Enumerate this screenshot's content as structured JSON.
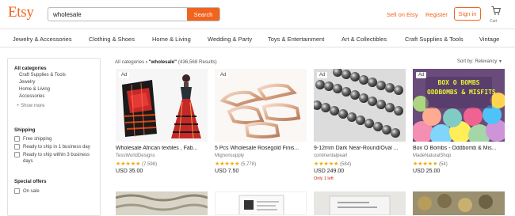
{
  "header": {
    "logo": "Etsy",
    "search_value": "wholesale",
    "search_button": "Search",
    "sell_link": "Sell on Etsy",
    "register_link": "Register",
    "signin_button": "Sign in",
    "cart_label": "Cart"
  },
  "categories": [
    "Jewelry & Accessories",
    "Clothing & Shoes",
    "Home & Living",
    "Wedding & Party",
    "Toys & Entertainment",
    "Art & Collectibles",
    "Craft Supplies & Tools",
    "Vintage"
  ],
  "sidebar": {
    "all_categories_heading": "All categories",
    "subcategories": [
      "Craft Supplies & Tools",
      "Jewelry",
      "Home & Living",
      "Accessories"
    ],
    "show_more": "+ Show more",
    "shipping_heading": "Shipping",
    "shipping_options": [
      "Free shipping",
      "Ready to ship in 1 business day",
      "Ready to ship within 3 business",
      "days"
    ],
    "special_heading": "Special offers",
    "special_options": [
      "On sale"
    ]
  },
  "results": {
    "crumb_all": "All categories",
    "crumb_query": "\"wholesale\"",
    "crumb_count": "(436,568 Results)",
    "sort_label": "Sort by: Relevancy"
  },
  "listings": [
    {
      "ad": "Ad",
      "title": "Wholesale African textiles , Fab...",
      "shop": "TessWorldDesigns",
      "stars": "★★★★★",
      "reviews": "(7,598)",
      "price": "USD 35.00",
      "note": ""
    },
    {
      "ad": "Ad",
      "title": "5 Pcs Wholesale Rosegold Finis...",
      "shop": "Mignonsupply",
      "stars": "★★★★★",
      "reviews": "(5,778)",
      "price": "USD 7.50",
      "note": ""
    },
    {
      "ad": "Ad",
      "title": "9-12mm Dark Near-Round/Oval ...",
      "shop": "continentalpearl",
      "stars": "★★★★★",
      "reviews": "(584)",
      "price": "USD 249.00",
      "note": "Only 1 left"
    },
    {
      "ad": "Ad",
      "title": "Box O Bombs - Oddbomb & Mis...",
      "shop": "MadeNaturalShop",
      "stars": "★★★★★",
      "reviews": "(54)",
      "price": "USD 25.00",
      "note": ""
    }
  ],
  "bomb_text": "BOX O BOMBS\nODDBOMBS & MISFITS",
  "colors": {
    "brand": "#f1641e",
    "star": "#f0ab00",
    "alert": "#c5221f"
  }
}
